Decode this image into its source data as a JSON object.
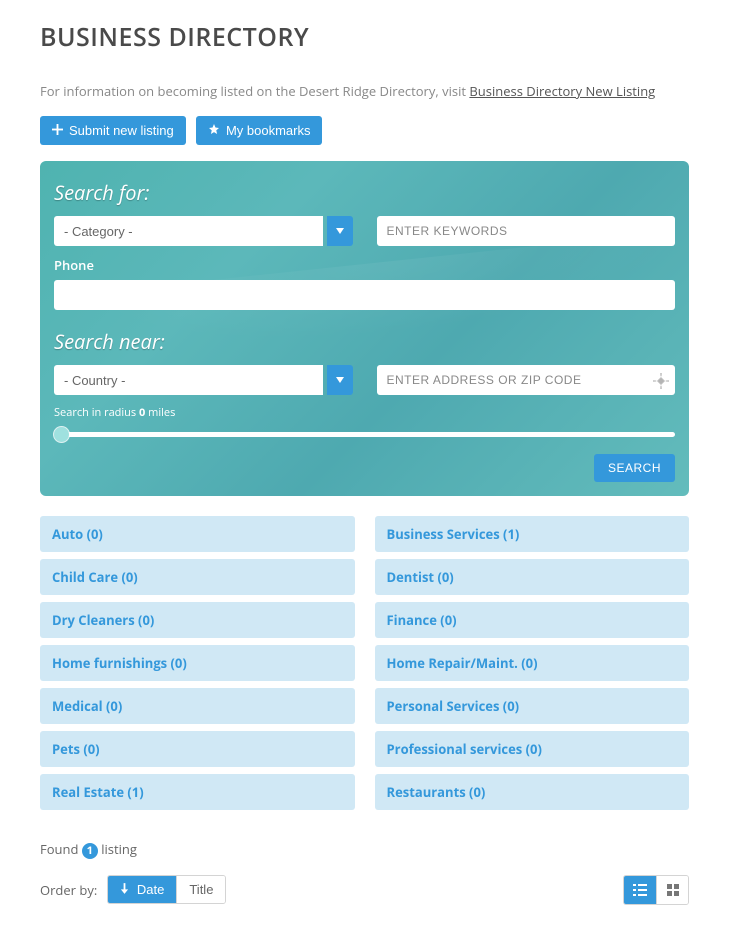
{
  "title": "BUSINESS DIRECTORY",
  "intro": {
    "prefix": "For information on becoming listed on the Desert Ridge Directory, visit ",
    "link": "Business Directory New Listing"
  },
  "top_buttons": {
    "submit": "Submit new listing",
    "bookmarks": "My bookmarks"
  },
  "search": {
    "for_label": "Search for:",
    "category_placeholder": "- Category -",
    "keywords_placeholder": "ENTER KEYWORDS",
    "phone_label": "Phone",
    "near_label": "Search near:",
    "country_placeholder": "- Country -",
    "address_placeholder": "ENTER ADDRESS OR ZIP CODE",
    "radius_prefix": "Search in radius ",
    "radius_value": "0",
    "radius_suffix": " miles",
    "search_button": "SEARCH"
  },
  "categories": [
    {
      "label": "Auto (0)"
    },
    {
      "label": "Business Services (1)"
    },
    {
      "label": "Child Care (0)"
    },
    {
      "label": "Dentist (0)"
    },
    {
      "label": "Dry Cleaners (0)"
    },
    {
      "label": "Finance (0)"
    },
    {
      "label": "Home furnishings (0)"
    },
    {
      "label": "Home Repair/Maint. (0)"
    },
    {
      "label": "Medical (0)"
    },
    {
      "label": "Personal Services (0)"
    },
    {
      "label": "Pets (0)"
    },
    {
      "label": "Professional services (0)"
    },
    {
      "label": "Real Estate (1)"
    },
    {
      "label": "Restaurants (0)"
    }
  ],
  "results": {
    "found_prefix": "Found ",
    "count": "1",
    "found_suffix": " listing"
  },
  "order": {
    "label": "Order by:",
    "date": "Date",
    "title": "Title"
  }
}
